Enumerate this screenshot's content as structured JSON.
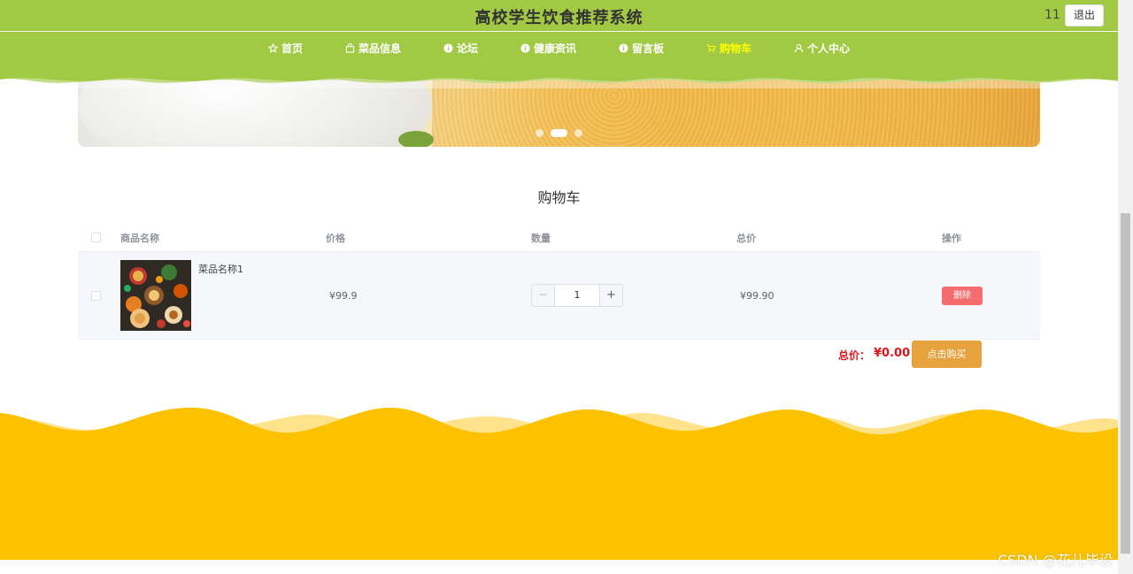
{
  "header": {
    "title": "高校学生饮食推荐系统",
    "user_name": "11",
    "logout_label": "退出",
    "bg_color": "#a2c944"
  },
  "nav": {
    "items": [
      {
        "label": "首页",
        "icon": "star-icon"
      },
      {
        "label": "菜品信息",
        "icon": "shopping-bag-icon"
      },
      {
        "label": "论坛",
        "icon": "info-circle-icon"
      },
      {
        "label": "健康资讯",
        "icon": "info-circle-icon"
      },
      {
        "label": "留言板",
        "icon": "info-circle-icon"
      },
      {
        "label": "购物车",
        "icon": "cart-icon",
        "active": true
      },
      {
        "label": "个人中心",
        "icon": "user-icon"
      }
    ],
    "active_color": "#ffff00"
  },
  "carousel": {
    "slides": 3,
    "active_index": 1
  },
  "cart": {
    "title": "购物车",
    "columns": [
      "商品名称",
      "价格",
      "数量",
      "总价",
      "操作"
    ],
    "rows": [
      {
        "name": "菜品名称1",
        "price": "¥99.9",
        "quantity": "1",
        "total": "¥99.90",
        "delete_label": "删除"
      }
    ],
    "summary_label": "总价：",
    "summary_value": "¥0.00",
    "buy_label": "点击购买"
  },
  "footer": {
    "color": "#fcc200"
  },
  "watermark": "CSDN @花儿毕设"
}
